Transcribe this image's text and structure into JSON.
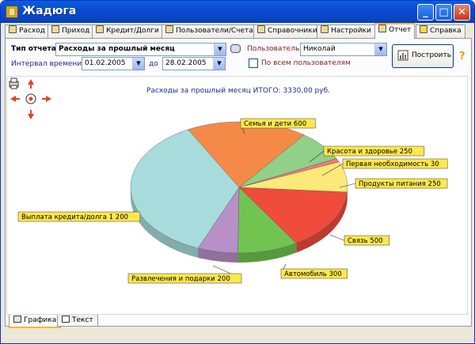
{
  "window": {
    "title": "Жадюга",
    "minimize_glyph": "_",
    "maximize_glyph": "□",
    "close_glyph": "✕"
  },
  "tabs": [
    {
      "label": "Расход",
      "icon": "expense-icon"
    },
    {
      "label": "Приход",
      "icon": "income-icon"
    },
    {
      "label": "Кредит/Долги",
      "icon": "credit-icon"
    },
    {
      "label": "Пользователи/Счета",
      "icon": "users-icon"
    },
    {
      "label": "Справочники",
      "icon": "directory-icon"
    },
    {
      "label": "Настройки",
      "icon": "settings-icon"
    },
    {
      "label": "Отчет",
      "icon": "report-icon",
      "active": true
    },
    {
      "label": "Справка",
      "icon": "help-icon"
    }
  ],
  "controls": {
    "report_type_label": "Тип отчета:",
    "report_type_value": "Расходы за прошлый месяц",
    "user_label": "Пользователь:",
    "user_value": "Николай",
    "interval_label": "Интервал времени от",
    "date_from": "01.02.2005",
    "to_label": "до",
    "date_to": "28.02.2005",
    "all_users_label": "По всем пользователям",
    "all_users_checked": false,
    "build_button": "Построить",
    "help_glyph": "?"
  },
  "bottom_tabs": [
    {
      "label": "Графика",
      "active": true
    },
    {
      "label": "Текст",
      "active": false
    }
  ],
  "colors": {
    "accent_tab": "#f7b73c",
    "title_text": "#1a2a8c",
    "nav_arrow": "#e0442a",
    "label_fill": "#ffe84a"
  },
  "chart_data": {
    "type": "pie",
    "title": "Расходы за прошлый месяц ИТОГО: 3330,00 руб.",
    "total": 3330,
    "slices": [
      {
        "label": "Семья и дети 600",
        "value": 600,
        "color": "#f58a48"
      },
      {
        "label": "Красота и здоровье 250",
        "value": 250,
        "color": "#90d088"
      },
      {
        "label": "Первая необходимость 30",
        "value": 30,
        "color": "#f07a7a"
      },
      {
        "label": "Продукты питания 250",
        "value": 250,
        "color": "#fce97a"
      },
      {
        "label": "Связь 500",
        "value": 500,
        "color": "#f04c3c"
      },
      {
        "label": "Автомобиль 300",
        "value": 300,
        "color": "#72c450"
      },
      {
        "label": "Развлечения и подарки 200",
        "value": 200,
        "color": "#b890c8"
      },
      {
        "label": "Выплата кредита/долга 1 200",
        "value": 1200,
        "color": "#a8dcdc"
      }
    ]
  }
}
